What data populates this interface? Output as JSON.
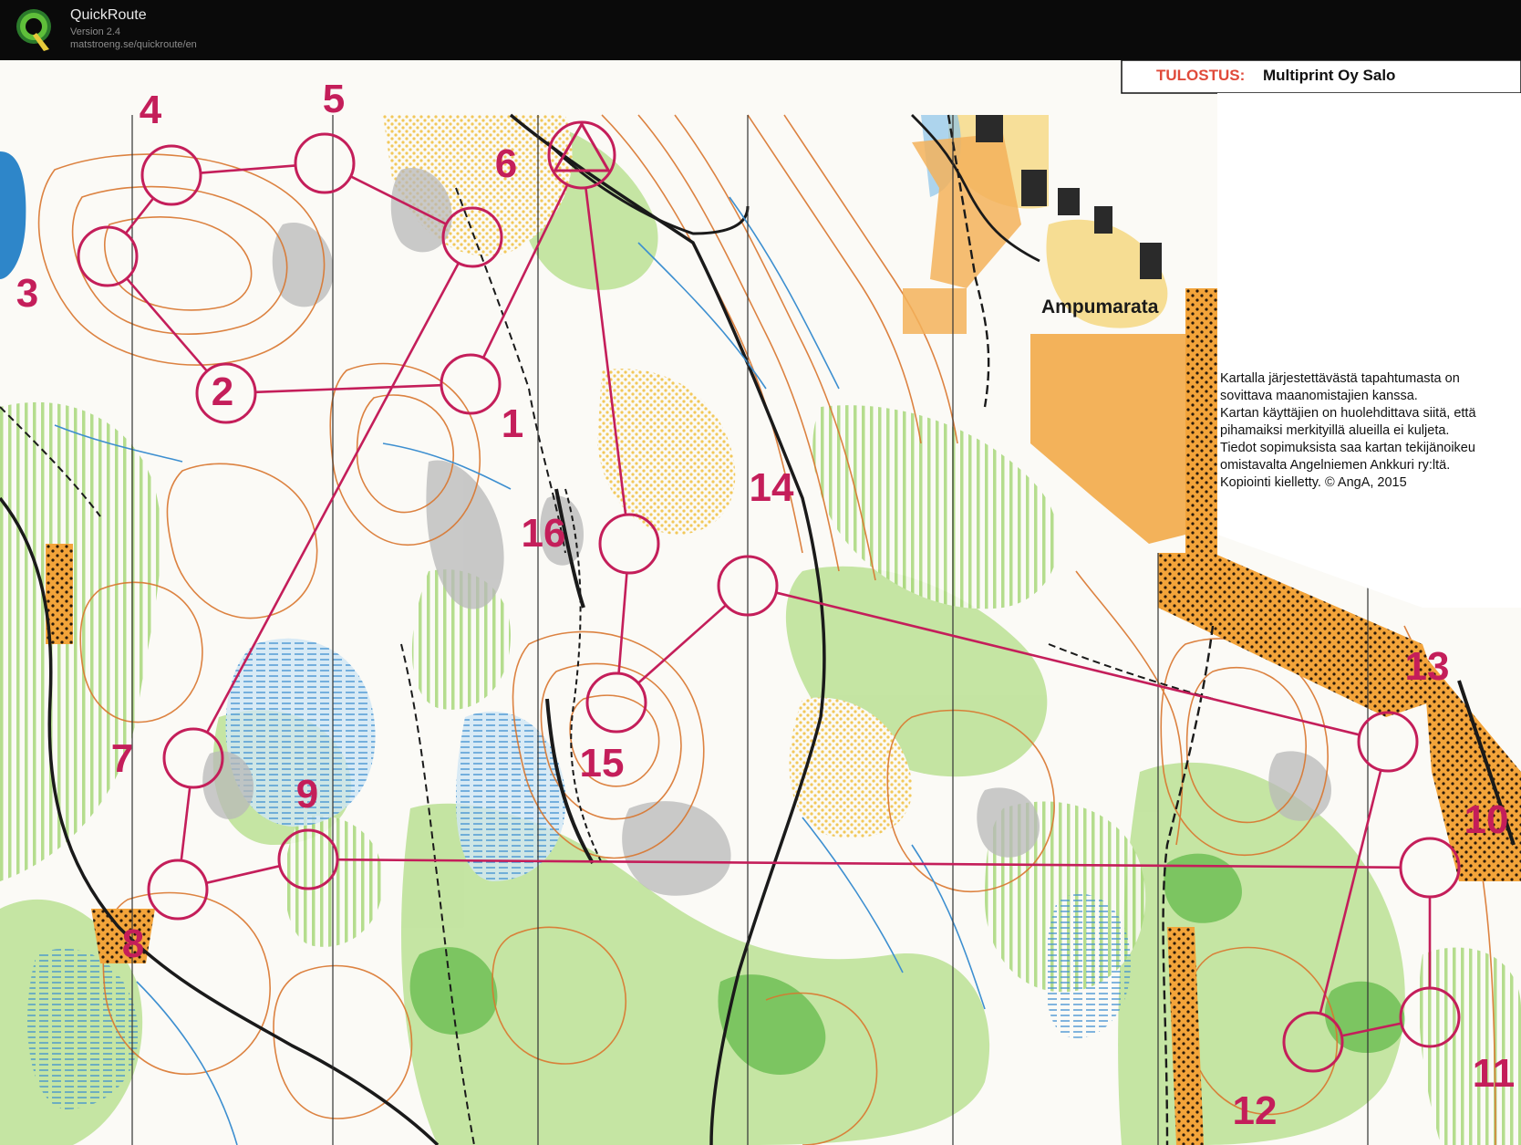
{
  "app": {
    "name": "QuickRoute",
    "version": "Version 2.4",
    "url": "matstroeng.se/quickroute/en",
    "logo_letter": "Q"
  },
  "colors": {
    "course": "#c41e5a",
    "contour": "#d9762e",
    "forest_green": "#9ccf6a",
    "marsh_blue": "#3d8fd0",
    "open_yellow": "#f5d67a",
    "orange_area": "#f0a640",
    "rock_grey": "#a8a8a8",
    "paper": "#fbfaf6"
  },
  "map": {
    "print_label": "TULOSTUS:",
    "print_value": "Multiprint Oy Salo",
    "place_name": "Ampumarata",
    "notes": [
      "Kartalla järjestettävästä tapahtumasta on",
      "sovittava maanomistajien kanssa.",
      "Kartan käyttäjien on huolehdittava siitä, että",
      "pihamaiksi merkityillä alueilla ei kuljeta.",
      "Tiedot sopimuksista saa kartan tekijänoikeu",
      "omistavalta Angelniemen Ankkuri ry:ltä.",
      "Kopiointi kielletty. © AngA, 2015"
    ]
  },
  "course": {
    "start_label": "start-triangle",
    "controls": [
      {
        "number": "1"
      },
      {
        "number": "2"
      },
      {
        "number": "3"
      },
      {
        "number": "4"
      },
      {
        "number": "5"
      },
      {
        "number": "6"
      },
      {
        "number": "7"
      },
      {
        "number": "8"
      },
      {
        "number": "9"
      },
      {
        "number": "10"
      },
      {
        "number": "11"
      },
      {
        "number": "12"
      },
      {
        "number": "13"
      },
      {
        "number": "14"
      },
      {
        "number": "15"
      },
      {
        "number": "16"
      }
    ]
  }
}
